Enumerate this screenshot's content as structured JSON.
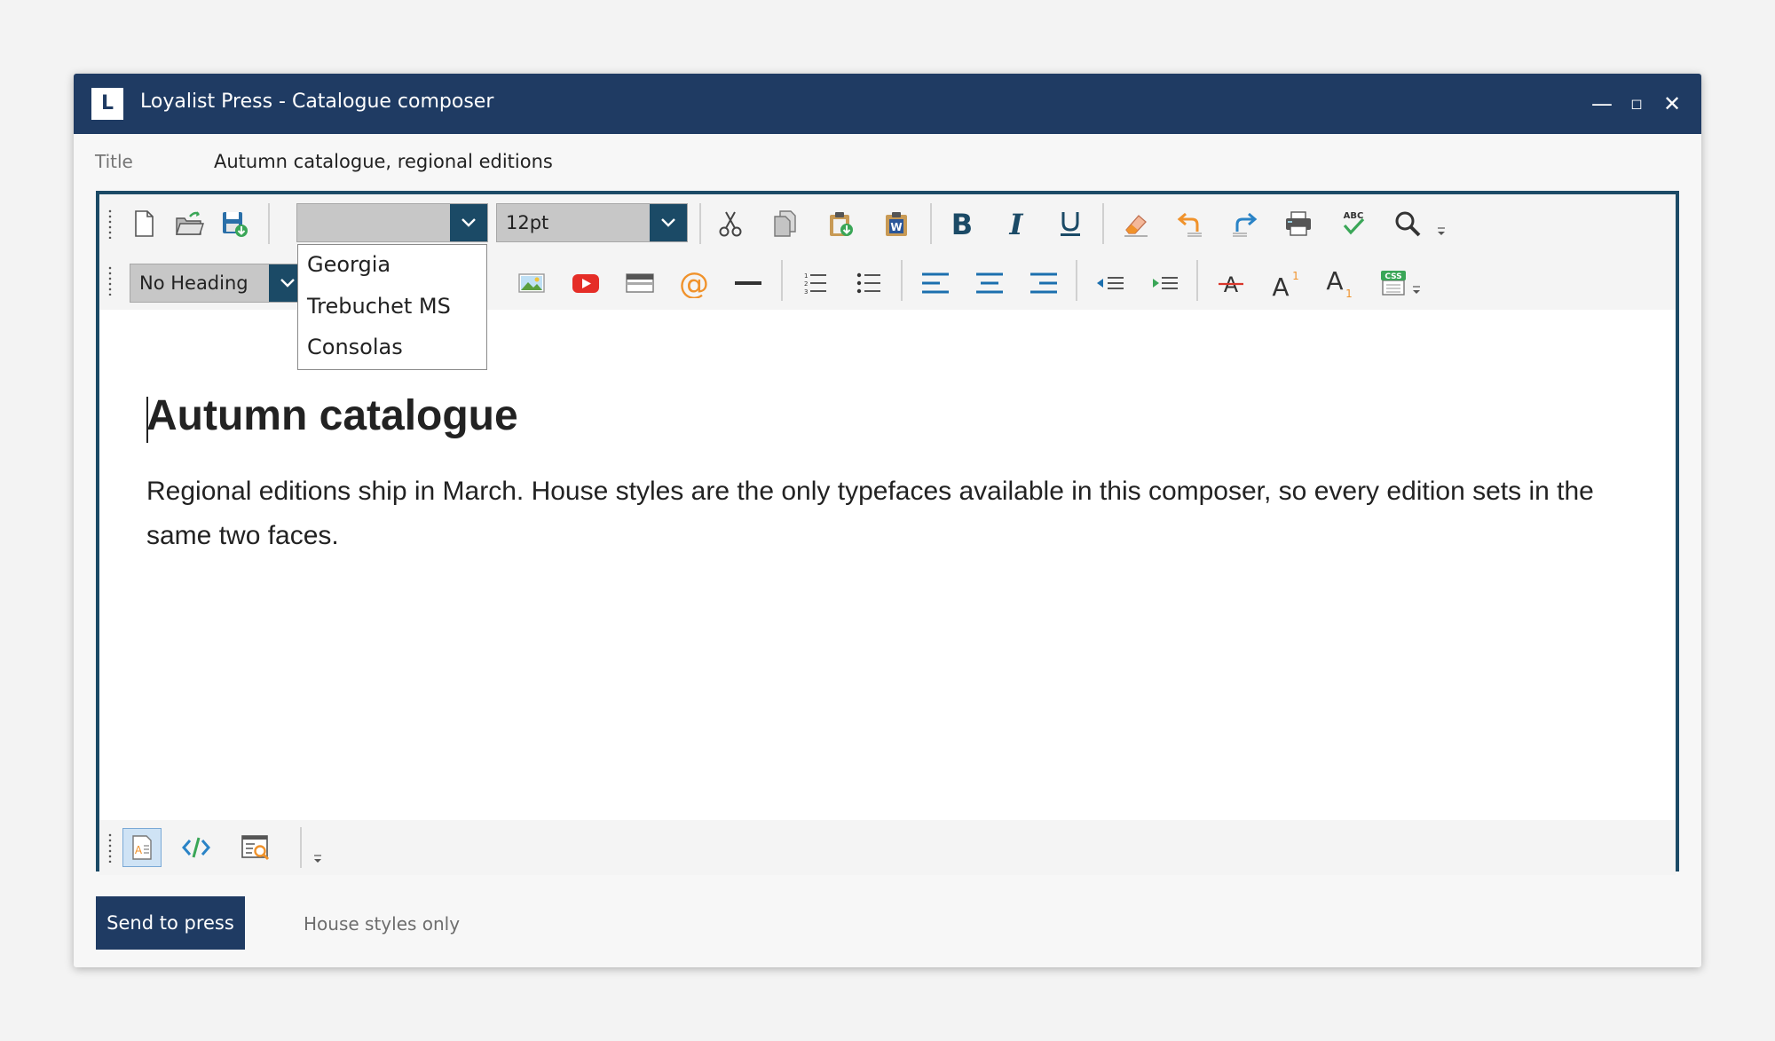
{
  "window": {
    "logo_letter": "L",
    "title": "Loyalist Press - Catalogue composer",
    "controls": {
      "minimize": "—",
      "maximize": "◻",
      "close": "✕"
    }
  },
  "title_field": {
    "label": "Title",
    "value": "Autumn catalogue, regional editions"
  },
  "toolbar": {
    "font_combo_value": "",
    "size_combo_value": "12pt",
    "heading_combo_value": "No Heading",
    "font_options": [
      "Georgia",
      "Trebuchet MS",
      "Consolas"
    ],
    "icons_row1": [
      "new-document-icon",
      "open-folder-icon",
      "save-icon",
      "cut-icon",
      "copy-icon",
      "paste-icon",
      "paste-from-word-icon",
      "bold-icon",
      "italic-icon",
      "underline-icon",
      "eraser-icon",
      "undo-icon",
      "redo-icon",
      "print-icon",
      "spellcheck-icon",
      "search-icon"
    ],
    "icons_row2": [
      "image-icon",
      "video-icon",
      "table-icon",
      "at-sign-icon",
      "horizontal-rule-icon",
      "numbered-list-icon",
      "bullet-list-icon",
      "align-left-icon",
      "align-center-icon",
      "align-right-icon",
      "outdent-icon",
      "indent-icon",
      "strikethrough-icon",
      "superscript-icon",
      "subscript-icon",
      "css-icon"
    ],
    "icons_bottom": [
      "design-view-icon",
      "code-view-icon",
      "preview-icon"
    ],
    "spellcheck_label": "ABC",
    "css_label": "CSS",
    "superscript_glyph": "A",
    "superscript_mark": "1",
    "subscript_glyph": "A",
    "subscript_mark": "1"
  },
  "document": {
    "heading": "Autumn catalogue",
    "paragraph": "Regional editions ship in March. House styles are the only typefaces available in this composer, so every edition sets in the same two faces."
  },
  "footer": {
    "send_label": "Send to press",
    "note": "House styles only"
  },
  "colors": {
    "titlebar": "#1f3b63",
    "editor_border": "#1b4a66",
    "accent": "#1b4a66",
    "orange": "#f0922b",
    "green": "#3aa657",
    "blue": "#2a83c6"
  }
}
